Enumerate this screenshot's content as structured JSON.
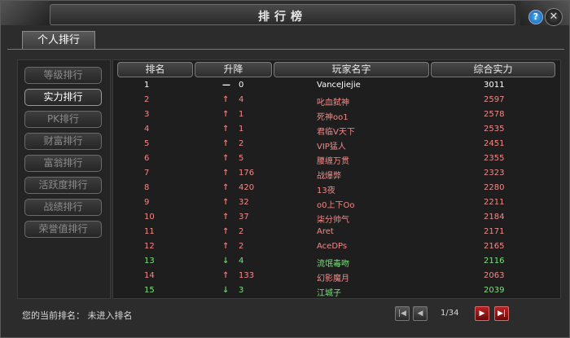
{
  "window": {
    "title": "排行榜"
  },
  "tab": {
    "label": "个人排行"
  },
  "sidebar": {
    "items": [
      {
        "label": "等级排行"
      },
      {
        "label": "实力排行"
      },
      {
        "label": "PK排行"
      },
      {
        "label": "财富排行"
      },
      {
        "label": "富翁排行"
      },
      {
        "label": "活跃度排行"
      },
      {
        "label": "战绩排行"
      },
      {
        "label": "荣誉值排行"
      }
    ]
  },
  "table": {
    "headers": [
      "排名",
      "升降",
      "玩家名字",
      "综合实力"
    ],
    "rows": [
      {
        "rank": "1",
        "arrow": "—",
        "change": "0",
        "name": "VanceJiejie",
        "power": "3011",
        "color": "#ffffff"
      },
      {
        "rank": "2",
        "arrow": "↑",
        "change": "4",
        "name": "叱血弑神",
        "power": "2597",
        "color": "#f08a8a"
      },
      {
        "rank": "3",
        "arrow": "↑",
        "change": "1",
        "name": "死神oo1",
        "power": "2578",
        "color": "#f08a8a"
      },
      {
        "rank": "4",
        "arrow": "↑",
        "change": "1",
        "name": "君临V天下",
        "power": "2535",
        "color": "#f08a8a"
      },
      {
        "rank": "5",
        "arrow": "↑",
        "change": "2",
        "name": "VIP猛人",
        "power": "2451",
        "color": "#f08a8a"
      },
      {
        "rank": "6",
        "arrow": "↑",
        "change": "5",
        "name": "腰缠万贯",
        "power": "2355",
        "color": "#f08a8a"
      },
      {
        "rank": "7",
        "arrow": "↑",
        "change": "176",
        "name": "战爆弊",
        "power": "2323",
        "color": "#f08a8a"
      },
      {
        "rank": "8",
        "arrow": "↑",
        "change": "420",
        "name": "13夜",
        "power": "2280",
        "color": "#f08a8a"
      },
      {
        "rank": "9",
        "arrow": "↑",
        "change": "32",
        "name": "o0上下Oo",
        "power": "2211",
        "color": "#f08a8a"
      },
      {
        "rank": "10",
        "arrow": "↑",
        "change": "37",
        "name": "柒分帅气",
        "power": "2184",
        "color": "#f08a8a"
      },
      {
        "rank": "11",
        "arrow": "↑",
        "change": "2",
        "name": "Aret",
        "power": "2171",
        "color": "#f08a8a"
      },
      {
        "rank": "12",
        "arrow": "↑",
        "change": "2",
        "name": "AceDPs",
        "power": "2165",
        "color": "#f08a8a"
      },
      {
        "rank": "13",
        "arrow": "↓",
        "change": "4",
        "name": "流氓毒吻",
        "power": "2116",
        "color": "#7ee07e"
      },
      {
        "rank": "14",
        "arrow": "↑",
        "change": "133",
        "name": "幻影魔月",
        "power": "2063",
        "color": "#f08a8a"
      },
      {
        "rank": "15",
        "arrow": "↓",
        "change": "3",
        "name": "江城子",
        "power": "2039",
        "color": "#7ee07e"
      }
    ]
  },
  "status": {
    "current_rank": "您的当前排名：  未进入排名"
  },
  "pager": {
    "page": "1/34"
  },
  "colors": {
    "accent": "#c0c0c0",
    "up": "#ff6b6b",
    "down": "#55d855"
  }
}
